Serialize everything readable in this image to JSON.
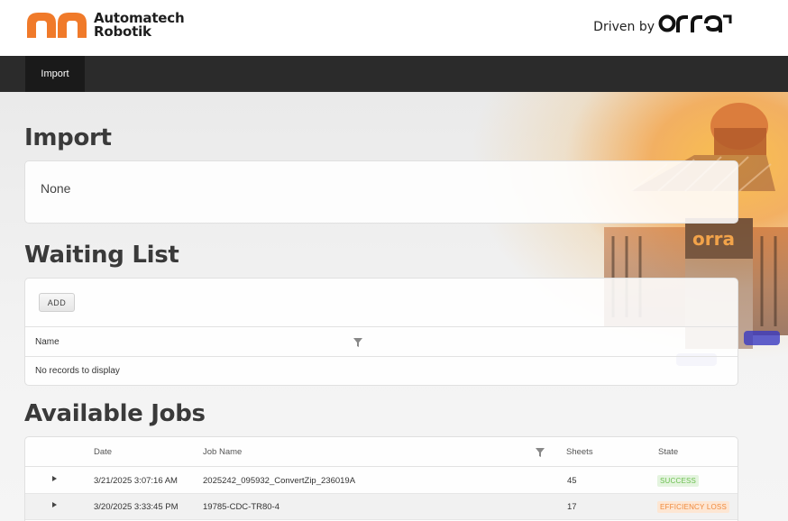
{
  "header": {
    "brand_line1": "Automatech",
    "brand_line2": "Robotik",
    "driven_by": "Driven by",
    "partner_logo": "orra"
  },
  "nav": {
    "tabs": [
      {
        "label": "Import",
        "active": true
      }
    ]
  },
  "import_section": {
    "title": "Import",
    "value": "None"
  },
  "waiting_list": {
    "title": "Waiting List",
    "add_label": "ADD",
    "columns": [
      "Name"
    ],
    "empty_text": "No records to display"
  },
  "available_jobs": {
    "title": "Available Jobs",
    "columns": [
      "Date",
      "Job Name",
      "Sheets",
      "State"
    ],
    "rows": [
      {
        "date": "3/21/2025 3:07:16 AM",
        "job_name": "2025242_095932_ConvertZip_236019A",
        "sheets": "45",
        "state": "SUCCESS",
        "state_color": "#6bbf4f"
      },
      {
        "date": "3/20/2025 3:33:45 PM",
        "job_name": "19785-CDC-TR80-4",
        "sheets": "17",
        "state": "EFFICIENCY LOSS",
        "state_color": "#f08a3c"
      }
    ]
  },
  "colors": {
    "brand_orange": "#f07a2a",
    "nav_bg": "#2b2b2b",
    "nav_active_bg": "#1a1a1a"
  }
}
